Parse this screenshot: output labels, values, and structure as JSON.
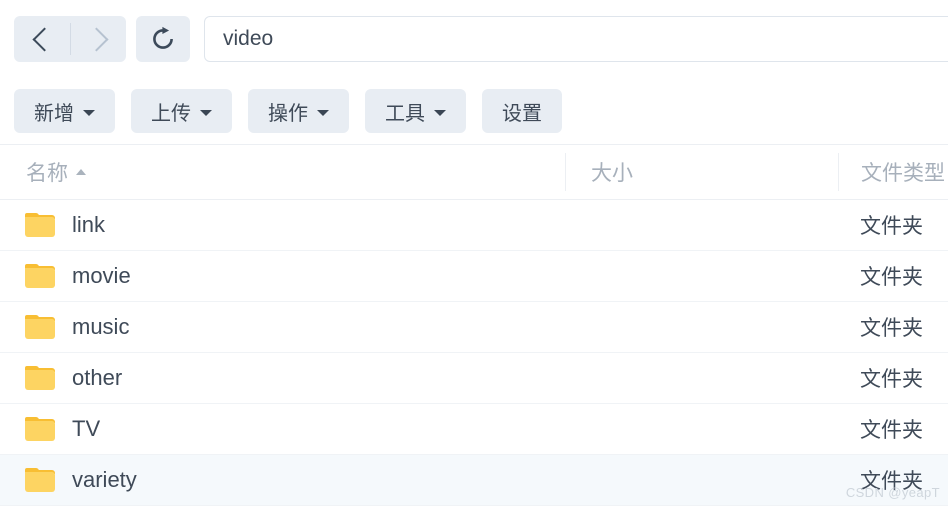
{
  "nav": {
    "back_icon": "chevron-left-icon",
    "forward_icon": "chevron-right-icon",
    "refresh_icon": "refresh-icon",
    "address_value": "video",
    "address_placeholder": ""
  },
  "toolbar": {
    "buttons": [
      {
        "label": "新增",
        "has_caret": true
      },
      {
        "label": "上传",
        "has_caret": true
      },
      {
        "label": "操作",
        "has_caret": true
      },
      {
        "label": "工具",
        "has_caret": true
      },
      {
        "label": "设置",
        "has_caret": false
      }
    ]
  },
  "table": {
    "columns": [
      {
        "label": "名称",
        "sorted": "asc"
      },
      {
        "label": "大小",
        "sorted": ""
      },
      {
        "label": "文件类型",
        "sorted": ""
      }
    ],
    "rows": [
      {
        "icon": "folder-icon",
        "name": "link",
        "size": "",
        "type": "文件夹",
        "selected": false
      },
      {
        "icon": "folder-icon",
        "name": "movie",
        "size": "",
        "type": "文件夹",
        "selected": false
      },
      {
        "icon": "folder-icon",
        "name": "music",
        "size": "",
        "type": "文件夹",
        "selected": false
      },
      {
        "icon": "folder-icon",
        "name": "other",
        "size": "",
        "type": "文件夹",
        "selected": false
      },
      {
        "icon": "folder-icon",
        "name": "TV",
        "size": "",
        "type": "文件夹",
        "selected": false
      },
      {
        "icon": "folder-icon",
        "name": "variety",
        "size": "",
        "type": "文件夹",
        "selected": true
      }
    ]
  },
  "watermark": {
    "text": "CSDN @yeapT"
  },
  "colors": {
    "button_bg": "#e8edf3",
    "text": "#3f4a58",
    "muted": "#a7b0bb",
    "folder_top": "#f8be33",
    "folder_body": "#fdd462",
    "row_selected": "#f5f9fc"
  }
}
